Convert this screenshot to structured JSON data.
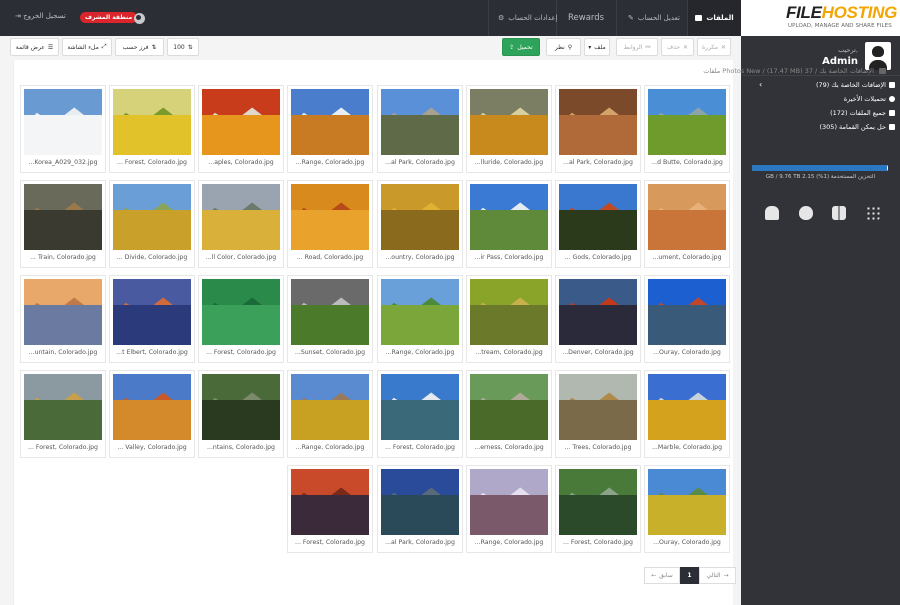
{
  "topbar": {
    "files": "الملفات",
    "links": "تعديل الحساب",
    "rewards": "Rewards",
    "settings": "إعدادات الحساب",
    "admin_area": "منطقة المشرف",
    "logout": "تسجيل الخروج"
  },
  "sidebar": {
    "logo_main_a": "FILE",
    "logo_main_b": "HOSTING",
    "logo_tagline": "UPLOAD, MANAGE AND SHARE FILES",
    "welcome": "ترحيب,",
    "username": "Admin",
    "nav": [
      {
        "label": "الإضافات الخاصة بك (79)"
      },
      {
        "label": "تحميلات الأخيرة"
      },
      {
        "label": "جميع الملفات (172)"
      },
      {
        "label": "حل يمكن القمامة (305)"
      }
    ],
    "storage_fraction": 0.99,
    "storage_text": "GB / 9.76 TB 2.15 التخزين المستخدمة (1%)"
  },
  "toolbar": {
    "upload": "تحميل",
    "search": "نظر",
    "file_menu": "ملف",
    "links": "الروابط",
    "delete": "حذف",
    "duplicate": "مكررة",
    "per_page": "100",
    "sort_by": "فرز حسب",
    "fullscreen": "ملء الشاشة",
    "list_view": "عرض قائمة"
  },
  "breadcrumb": {
    "root": "الإضافات الخاصة بك",
    "folder": "Photos New",
    "meta": "(17.47 MB) 37 ملفات"
  },
  "files": [
    {
      "name": "...d Butte, Colorado.jpg",
      "sky": "#4a8fd6",
      "mid": "#8ba4a8",
      "ground": "#6f9a2c"
    },
    {
      "name": "...al Park, Colorado.jpg",
      "sky": "#7b4a2a",
      "mid": "#d4a26a",
      "ground": "#b06a3a"
    },
    {
      "name": "...lluride, Colorado.jpg",
      "sky": "#7b7e62",
      "mid": "#d8cfa0",
      "ground": "#c88a1c"
    },
    {
      "name": "...al Park, Colorado.jpg",
      "sky": "#5a90d8",
      "mid": "#a8a090",
      "ground": "#5f6a48"
    },
    {
      "name": "...Range, Colorado.jpg",
      "sky": "#4a7ecc",
      "mid": "#e8eef4",
      "ground": "#c97b24"
    },
    {
      "name": "...aples, Colorado.jpg",
      "sky": "#c83c1c",
      "mid": "#e0d8cc",
      "ground": "#e6961c"
    },
    {
      "name": "... Forest, Colorado.jpg",
      "sky": "#d6d27a",
      "mid": "#7a9a2c",
      "ground": "#e1c22a"
    },
    {
      "name": "...Korea_A029_032.jpg",
      "sky": "#6a9ad2",
      "mid": "#e7edf2",
      "ground": "#f3f5f7"
    },
    {
      "name": "...ument, Colorado.jpg",
      "sky": "#d79a5c",
      "mid": "#e8b07a",
      "ground": "#c9753a"
    },
    {
      "name": "... Gods, Colorado.jpg",
      "sky": "#3a78d0",
      "mid": "#c24a22",
      "ground": "#2c3a1c"
    },
    {
      "name": "...ir Pass, Colorado.jpg",
      "sky": "#3a7ad4",
      "mid": "#e4ecf2",
      "ground": "#5f8a3a"
    },
    {
      "name": "...ountry, Colorado.jpg",
      "sky": "#c99a2a",
      "mid": "#e2b033",
      "ground": "#8a6a1c"
    },
    {
      "name": "... Road, Colorado.jpg",
      "sky": "#d88a1c",
      "mid": "#b84a1a",
      "ground": "#e9a22c"
    },
    {
      "name": "...ll Color, Colorado.jpg",
      "sky": "#9aa4b0",
      "mid": "#6b7a6a",
      "ground": "#d9b03a"
    },
    {
      "name": "... Divide, Colorado.jpg",
      "sky": "#6a9ed6",
      "mid": "#8aa45a",
      "ground": "#c9a02a"
    },
    {
      "name": "... Train, Colorado.jpg",
      "sky": "#6a6a5a",
      "mid": "#9a7a4a",
      "ground": "#3a3a30"
    },
    {
      "name": "...Ouray, Colorado.jpg",
      "sky": "#1c5fd0",
      "mid": "#c2462a",
      "ground": "#3a5a7a"
    },
    {
      "name": "...Denver, Colorado.jpg",
      "sky": "#3a5a8a",
      "mid": "#c23a1a",
      "ground": "#2a2a3a"
    },
    {
      "name": "...tream, Colorado.jpg",
      "sky": "#8aa42a",
      "mid": "#c8b04a",
      "ground": "#6a7a2a"
    },
    {
      "name": "...Range, Colorado.jpg",
      "sky": "#6aa0da",
      "mid": "#4a8a3a",
      "ground": "#7aa63a"
    },
    {
      "name": "...Sunset, Colorado.jpg",
      "sky": "#6a6a6a",
      "mid": "#bcbcbc",
      "ground": "#4a7a2a"
    },
    {
      "name": "... Forest, Colorado.jpg",
      "sky": "#2a8a4a",
      "mid": "#1a6a3a",
      "ground": "#3aa05a"
    },
    {
      "name": "...t Elbert, Colorado.jpg",
      "sky": "#4a5aa0",
      "mid": "#d26a3a",
      "ground": "#2a3a7a"
    },
    {
      "name": "...untain, Colorado.jpg",
      "sky": "#e8a86a",
      "mid": "#c07a4a",
      "ground": "#6a7aa0"
    },
    {
      "name": "...Marble, Colorado.jpg",
      "sky": "#3a6ed0",
      "mid": "#c8d2dc",
      "ground": "#d4a21c"
    },
    {
      "name": "... Trees, Colorado.jpg",
      "sky": "#b0b8b0",
      "mid": "#b08a4a",
      "ground": "#7a6a4a"
    },
    {
      "name": "...erness, Colorado.jpg",
      "sky": "#6a9a5a",
      "mid": "#b0aa9a",
      "ground": "#4a6a2a"
    },
    {
      "name": "... Forest, Colorado.jpg",
      "sky": "#3a7acc",
      "mid": "#e6eaee",
      "ground": "#3a6a7a"
    },
    {
      "name": "...Range, Colorado.jpg",
      "sky": "#5a8ad0",
      "mid": "#9a7a5a",
      "ground": "#c8a022"
    },
    {
      "name": "...ntains, Colorado.jpg",
      "sky": "#4a6a3a",
      "mid": "#7a8a6a",
      "ground": "#2a3a20"
    },
    {
      "name": "... Valley, Colorado.jpg",
      "sky": "#4a7ac8",
      "mid": "#c85a2a",
      "ground": "#d48a2a"
    },
    {
      "name": "... Forest, Colorado.jpg",
      "sky": "#8a9aa0",
      "mid": "#c8a04a",
      "ground": "#4a6a3a"
    },
    {
      "name": "...Ouray, Colorado.jpg",
      "sky": "#4a8ad4",
      "mid": "#5a8a4a",
      "ground": "#c8b02a"
    },
    {
      "name": "... Forest, Colorado.jpg",
      "sky": "#4a7a3a",
      "mid": "#8aa48a",
      "ground": "#2a4a2a"
    },
    {
      "name": "...Range, Colorado.jpg",
      "sky": "#b0a8c8",
      "mid": "#e6e0ee",
      "ground": "#7a5a6a"
    },
    {
      "name": "...al Park, Colorado.jpg",
      "sky": "#2a4a9a",
      "mid": "#5a6a7a",
      "ground": "#2a4a5a"
    },
    {
      "name": "... Forest, Colorado.jpg",
      "sky": "#c84a2a",
      "mid": "#7a2a1a",
      "ground": "#3a2a3a"
    }
  ],
  "pagination": {
    "next": "التالي",
    "current": "1",
    "prev": "سابق"
  }
}
